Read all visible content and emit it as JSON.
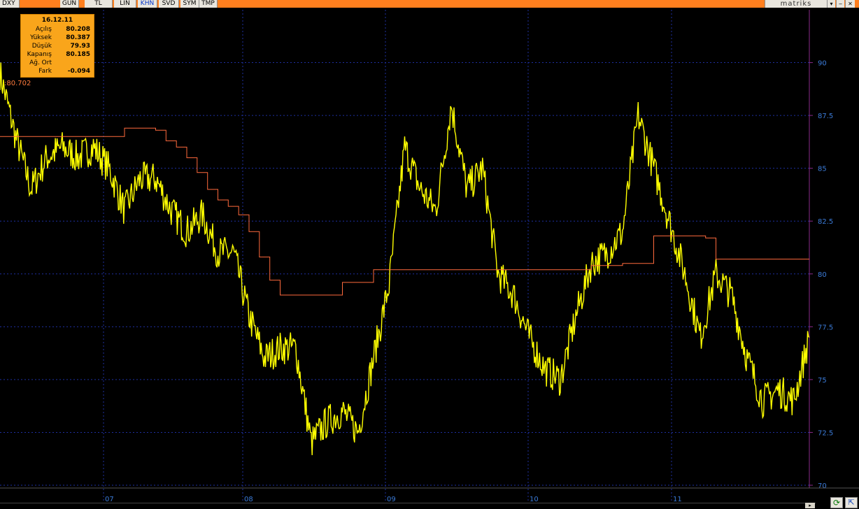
{
  "toolbar": {
    "symbol": "DXY",
    "tabs": [
      "GUN",
      "TL",
      "LIN",
      "KHN",
      "SVD",
      "SYM",
      "TMP"
    ],
    "active_tab": "KHN",
    "brand": "matriks",
    "dropdown_icon": "chevron-down-icon",
    "minimize_icon": "minimize-icon",
    "close_icon": "close-icon"
  },
  "colors": {
    "background": "#000000",
    "price_line": "#ffff00",
    "average_line": "#ff6a3d",
    "grid": "#1e2fa0",
    "axis": "#8a2a8a",
    "axis_text": "#3b7bd8",
    "toolbar": "#ff7f1e",
    "infobox": "#f9a51b"
  },
  "infobox": {
    "date": "16.12.11",
    "rows": [
      {
        "label": "Açılış",
        "value": "80.208"
      },
      {
        "label": "Yüksek",
        "value": "80.387"
      },
      {
        "label": "Düşük",
        "value": "79.93"
      },
      {
        "label": "Kapanış",
        "value": "80.185"
      },
      {
        "label": "Ağ. Ort",
        "value": ""
      },
      {
        "label": "Fark",
        "value": "-0.094"
      }
    ]
  },
  "avg_label": ":80.702",
  "chart_data": {
    "type": "line",
    "symbol": "DXY",
    "x_tick_labels": [
      "07",
      "08",
      "09",
      "10",
      "11"
    ],
    "y_tick_labels": [
      "90",
      "87.5",
      "85",
      "82.5",
      "80",
      "77.5",
      "75",
      "72.5",
      "70"
    ],
    "ylim": [
      70,
      92.5
    ],
    "grid": true,
    "y_axis_side": "right",
    "series": [
      {
        "style": "price",
        "x": [
          0,
          1.5,
          3,
          4.5,
          6,
          7.5,
          9,
          10.5,
          12,
          13.5,
          15,
          16.5,
          18,
          19.5,
          21,
          22.5,
          24,
          25.5,
          27,
          28.5,
          30,
          31.5,
          33,
          34.5,
          36,
          37.5,
          39,
          40.5,
          42,
          43.5,
          45,
          46.5,
          48,
          49.5,
          51,
          52.5,
          54,
          55.5,
          57,
          58.5,
          60,
          61.5,
          63,
          64.5,
          66,
          67.5,
          69,
          70.5,
          72,
          73.5,
          75,
          76.5,
          78
        ],
        "values": [
          89.5,
          86.5,
          84.0,
          85.5,
          86.0,
          85.5,
          86.0,
          85.0,
          83.0,
          84.5,
          84.5,
          83.0,
          82.0,
          82.8,
          81.0,
          81.0,
          78.0,
          76.0,
          76.5,
          76.5,
          72.0,
          73.0,
          73.5,
          72.5,
          76.0,
          79.5,
          86.0,
          84.0,
          83.0,
          88.0,
          84.0,
          85.0,
          80.0,
          79.0,
          77.0,
          75.5,
          75.0,
          78.0,
          80.5,
          81.0,
          82.0,
          87.5,
          85.0,
          82.5,
          80.0,
          77.0,
          80.0,
          79.0,
          76.0,
          74.0,
          74.5,
          74.0,
          77.0
        ]
      },
      {
        "style": "average",
        "x": [
          0,
          3,
          6,
          9,
          10.5,
          12,
          13,
          14,
          15,
          16,
          17,
          18,
          19,
          20,
          21,
          22,
          23,
          24,
          25,
          26,
          27,
          28,
          30,
          33,
          36,
          39,
          42,
          45,
          48,
          51,
          54,
          57,
          60,
          63,
          66,
          68,
          69,
          72,
          75,
          78
        ],
        "values": [
          86.5,
          86.5,
          86.5,
          86.5,
          86.5,
          86.9,
          86.9,
          86.9,
          86.8,
          86.3,
          86.0,
          85.5,
          84.8,
          84.0,
          83.5,
          83.2,
          82.8,
          82.0,
          80.8,
          79.7,
          79.0,
          79.0,
          79.0,
          79.6,
          80.2,
          80.2,
          80.2,
          80.2,
          80.2,
          80.2,
          80.2,
          80.4,
          80.5,
          81.8,
          81.8,
          81.7,
          80.7,
          80.7,
          80.7,
          80.7
        ]
      }
    ]
  }
}
